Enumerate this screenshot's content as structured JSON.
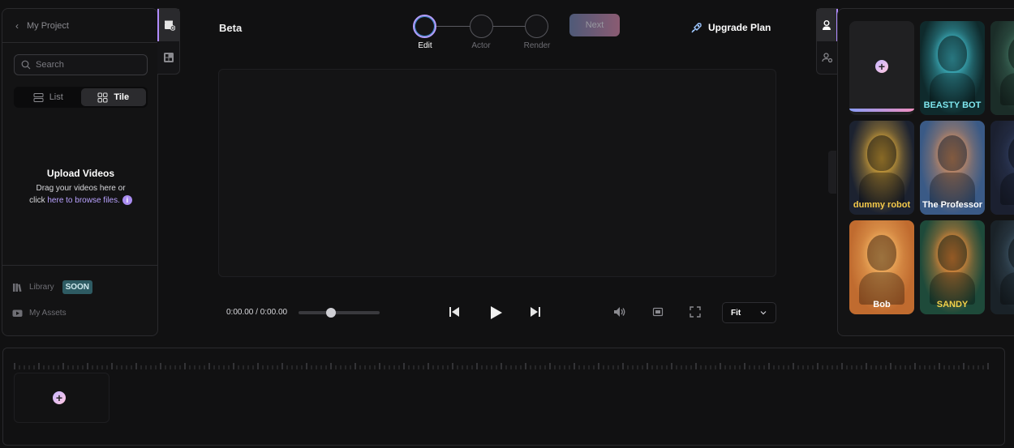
{
  "left_panel": {
    "back_label": "My Project",
    "search_placeholder": "Search",
    "view_toggle": {
      "list_label": "List",
      "tile_label": "Tile",
      "selected": "Tile"
    },
    "upload": {
      "title": "Upload Videos",
      "line1": "Drag your videos here or",
      "line2_prefix": "click ",
      "link_text": "here to browse files.",
      "info_glyph": "i"
    },
    "footer": {
      "library_label": "Library",
      "soon_badge": "SOON",
      "assets_label": "My Assets"
    }
  },
  "header": {
    "project_name": "Beta",
    "steps": [
      {
        "label": "Edit",
        "active": true
      },
      {
        "label": "Actor",
        "active": false
      },
      {
        "label": "Render",
        "active": false
      }
    ],
    "next_label": "Next",
    "upgrade_label": "Upgrade Plan"
  },
  "player": {
    "time_label": "0:00.00 / 0:00.00",
    "seek_progress_percent": 40,
    "fit_select_value": "Fit"
  },
  "actors": {
    "cards": [
      {
        "name": "",
        "kind": "add"
      },
      {
        "name": "BEASTY BOT",
        "kind": "actor",
        "bg": "#0f2a2c",
        "accent": "#3fb6c4",
        "text_color": "#7ee7ef"
      },
      {
        "name": "",
        "kind": "actor",
        "bg": "#1b2d28",
        "accent": "#3d6b5a",
        "text_color": "#ffffff"
      },
      {
        "name": "dummy robot",
        "kind": "actor",
        "bg": "#1c2230",
        "accent": "#d2a23a",
        "text_color": "#f4c94a"
      },
      {
        "name": "The Professor",
        "kind": "actor",
        "bg": "#3a5a86",
        "accent": "#c98b62",
        "text_color": "#ffffff"
      },
      {
        "name": "",
        "kind": "actor",
        "bg": "#1b2030",
        "accent": "#2e3a5a",
        "text_color": "#ffffff"
      },
      {
        "name": "Bob",
        "kind": "actor",
        "bg": "#c06b2f",
        "accent": "#f0b060",
        "text_color": "#ffffff"
      },
      {
        "name": "SANDY",
        "kind": "actor",
        "bg": "#1e4a3a",
        "accent": "#e48a3a",
        "text_color": "#f2d24a"
      },
      {
        "name": "",
        "kind": "actor",
        "bg": "#1a2228",
        "accent": "#3a5060",
        "text_color": "#ffffff"
      }
    ]
  },
  "timeline": {
    "add_glyph": "+"
  },
  "icons": {
    "back": "chevron-left-icon",
    "search": "search-icon",
    "list": "list-icon",
    "tile": "grid-icon",
    "library": "library-icon",
    "assets": "youtube-icon",
    "upgrade": "rocket-icon",
    "skip_back": "skip-back-icon",
    "play": "play-icon",
    "skip_forward": "skip-forward-icon",
    "volume": "volume-icon",
    "pip": "picture-in-picture-icon",
    "fullscreen": "fullscreen-icon",
    "chevron_down": "chevron-down-icon",
    "actor_tab": "user-icon",
    "actor_settings_tab": "user-settings-icon"
  },
  "colors": {
    "accent": "#b18cff",
    "link": "#b9a2ff",
    "soon_badge_bg": "#2e5b63"
  }
}
